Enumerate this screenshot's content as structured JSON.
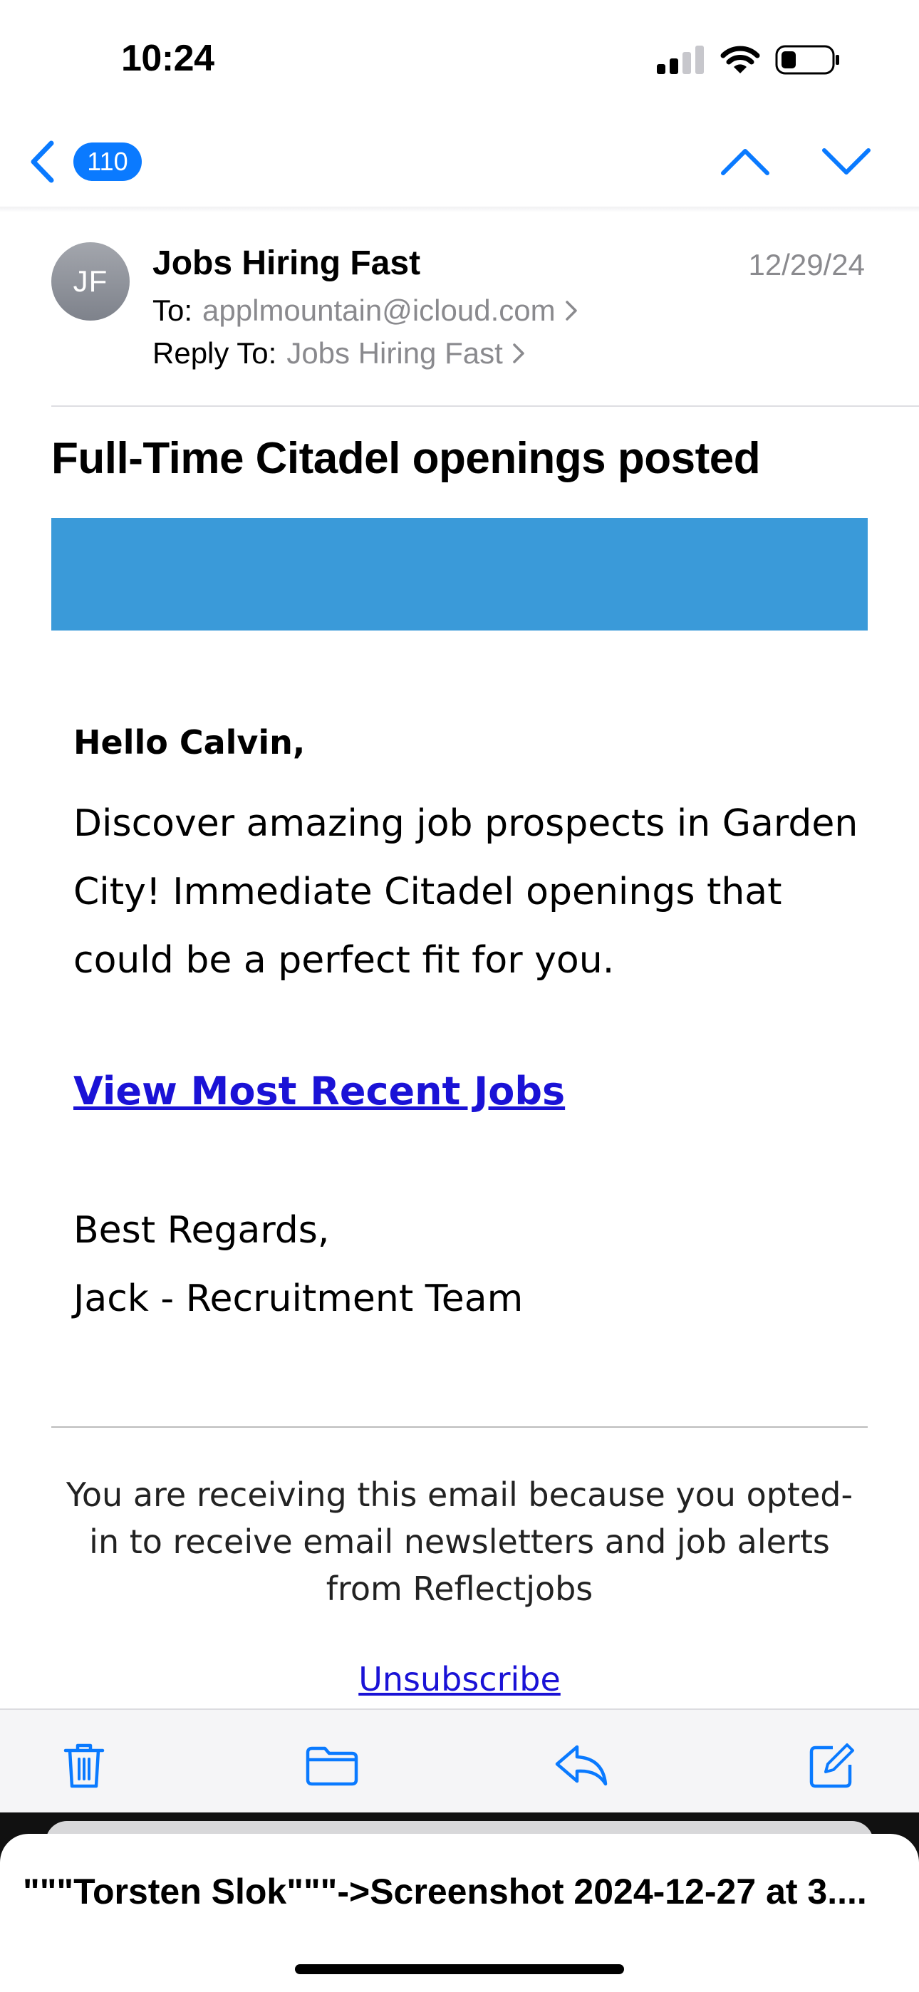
{
  "status_bar": {
    "time": "10:24"
  },
  "nav": {
    "back_count": "110"
  },
  "header": {
    "avatar_initials": "JF",
    "sender": "Jobs Hiring Fast",
    "date": "12/29/24",
    "to_label": "To:",
    "to_value": "applmountain@icloud.com",
    "reply_label": "Reply To:",
    "reply_value": "Jobs Hiring Fast"
  },
  "subject": "Full-Time Citadel openings posted",
  "body": {
    "banner_color": "#3a9ad9",
    "greeting": "Hello Calvin,",
    "intro": "Discover amazing job prospects in Garden City! Immediate Citadel openings that could be a perfect fit for you.",
    "link_text": "View Most Recent Jobs",
    "regards": "Best Regards,",
    "signature": "Jack - Recruitment Team",
    "footer_note": "You are receiving this email because you opted-in to receive email newsletters and job alerts from Reflectjobs",
    "unsubscribe": "Unsubscribe"
  },
  "toolbar": {
    "items": [
      "trash-icon",
      "folder-icon",
      "reply-icon",
      "compose-icon"
    ]
  },
  "bottom_sheet": {
    "title": "\"\"\"Torsten Slok\"\"\"->Screenshot 2024-12-27 at 3...."
  },
  "colors": {
    "accent": "#0a7aff",
    "link": "#1a12d6"
  }
}
